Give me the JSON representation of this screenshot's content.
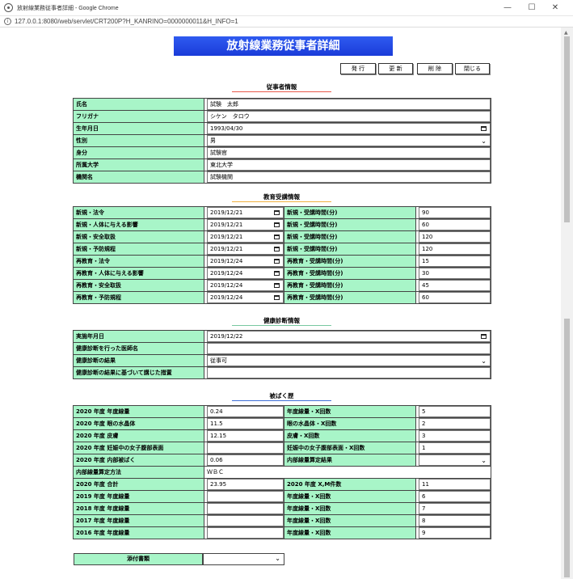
{
  "window": {
    "title": "放射線業務従事者詳細 - Google Chrome",
    "url": "127.0.0.1:8080/web/servlet/CRT200P?H_KANRINO=0000000011&H_INFO=1",
    "minimize": "—",
    "maximize": "☐",
    "close": "✕"
  },
  "page": {
    "title": "放射線業務従事者詳細"
  },
  "actions": {
    "issue": "発 行",
    "update": "更 新",
    "delete": "削 除",
    "close": "閉じる"
  },
  "colors": {
    "title_bg": "#1a3bd9",
    "label_bg": "#a8f5c8",
    "line_worker": "#e85a4a",
    "line_education": "#f0b040",
    "line_health": "#78c8a0",
    "line_exposure": "#3f6fd8"
  },
  "worker": {
    "title": "従事者情報",
    "rows": [
      {
        "label": "氏名",
        "value": "試験　太郎"
      },
      {
        "label": "フリガナ",
        "value": "シケン　タロウ"
      },
      {
        "label": "生年月日",
        "value": "1993/04/30"
      },
      {
        "label": "性別",
        "value": "男"
      },
      {
        "label": "身分",
        "value": "試験官"
      },
      {
        "label": "所属大学",
        "value": "東北大学"
      },
      {
        "label": "機関名",
        "value": "試験機関"
      }
    ]
  },
  "education": {
    "title": "教育受講情報",
    "rows": [
      {
        "label": "新規・法令",
        "date": "2019/12/21",
        "label2": "新規・受講時間(分)",
        "value": "90"
      },
      {
        "label": "新規・人体に与える影響",
        "date": "2019/12/21",
        "label2": "新規・受講時間(分)",
        "value": "60"
      },
      {
        "label": "新規・安全取扱",
        "date": "2019/12/21",
        "label2": "新規・受講時間(分)",
        "value": "120"
      },
      {
        "label": "新規・予防規程",
        "date": "2019/12/21",
        "label2": "新規・受講時間(分)",
        "value": "120"
      },
      {
        "label": "再教育・法令",
        "date": "2019/12/24",
        "label2": "再教育・受講時間(分)",
        "value": "15"
      },
      {
        "label": "再教育・人体に与える影響",
        "date": "2019/12/24",
        "label2": "再教育・受講時間(分)",
        "value": "30"
      },
      {
        "label": "再教育・安全取扱",
        "date": "2019/12/24",
        "label2": "再教育・受講時間(分)",
        "value": "45"
      },
      {
        "label": "再教育・予防規程",
        "date": "2019/12/24",
        "label2": "再教育・受講時間(分)",
        "value": "60"
      }
    ]
  },
  "health": {
    "title": "健康診断情報",
    "rows": [
      {
        "label": "実施年月日",
        "value": "2019/12/22"
      },
      {
        "label": "健康診断を行った医師名",
        "value": ""
      },
      {
        "label": "健康診断の結果",
        "value": "従事可"
      },
      {
        "label": "健康診断の結果に基づいて講じた措置",
        "value": ""
      }
    ]
  },
  "exposure": {
    "title": "被ばく歴",
    "rows": [
      {
        "label": "2020 年度 年度線量",
        "value": "0.24",
        "label2": "年度線量・X回数",
        "value2": "5"
      },
      {
        "label": "2020 年度 眼の水晶体",
        "value": "11.5",
        "label2": "眼の水晶体・X回数",
        "value2": "2"
      },
      {
        "label": "2020 年度 皮膚",
        "value": "12.15",
        "label2": "皮膚・X回数",
        "value2": "3"
      },
      {
        "label": "2020 年度 妊娠中の女子腹部表面",
        "value": "",
        "label2": "妊娠中の女子腹部表面・X回数",
        "value2": "1"
      },
      {
        "label": "2020 年度 内部被ばく",
        "value": "0.06",
        "label2": "内部線量算定結果",
        "value2": ""
      },
      {
        "label": "2020 年度 合計",
        "value": "23.95",
        "label2": "2020 年度 X,M件数",
        "value2": "11"
      },
      {
        "label": "2019 年度 年度線量",
        "value": "",
        "label2": "年度線量・X回数",
        "value2": "6"
      },
      {
        "label": "2018 年度 年度線量",
        "value": "",
        "label2": "年度線量・X回数",
        "value2": "7"
      },
      {
        "label": "2017 年度 年度線量",
        "value": "",
        "label2": "年度線量・X回数",
        "value2": "8"
      },
      {
        "label": "2016 年度 年度線量",
        "value": "",
        "label2": "年度線量・X回数",
        "value2": "9"
      }
    ],
    "method_label": "内部線量算定方法",
    "method_value": "ＷＢＣ"
  },
  "attachment": {
    "label": "添付書類",
    "value": ""
  }
}
